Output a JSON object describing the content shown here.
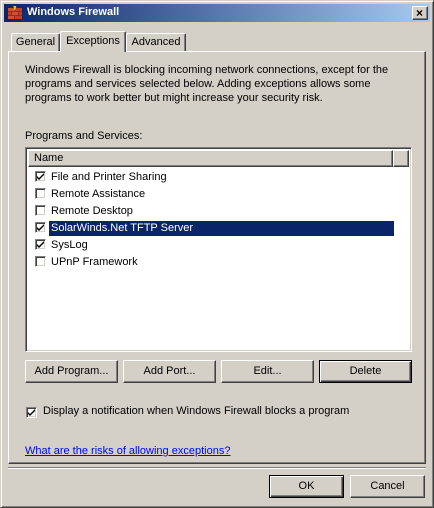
{
  "window": {
    "title": "Windows Firewall",
    "close_glyph": "×"
  },
  "tabs": [
    {
      "label": "General",
      "active": false
    },
    {
      "label": "Exceptions",
      "active": true
    },
    {
      "label": "Advanced",
      "active": false
    }
  ],
  "exceptions": {
    "description": "Windows Firewall is blocking incoming network connections, except for the programs and services selected below. Adding exceptions allows some programs to work better but might increase your security risk.",
    "section_label": "Programs and Services:",
    "column_header": "Name",
    "items": [
      {
        "label": "File and Printer Sharing",
        "checked": true,
        "selected": false
      },
      {
        "label": "Remote Assistance",
        "checked": false,
        "selected": false
      },
      {
        "label": "Remote Desktop",
        "checked": false,
        "selected": false
      },
      {
        "label": "SolarWinds.Net TFTP Server",
        "checked": true,
        "selected": true
      },
      {
        "label": "SysLog",
        "checked": true,
        "selected": false
      },
      {
        "label": "UPnP Framework",
        "checked": false,
        "selected": false
      }
    ],
    "buttons": {
      "add_program": "Add Program...",
      "add_port": "Add Port...",
      "edit": "Edit...",
      "delete": "Delete"
    },
    "notify_label": "Display a notification when Windows Firewall blocks a program",
    "notify_checked": true,
    "risk_link": "What are the risks of allowing exceptions?"
  },
  "footer": {
    "ok": "OK",
    "cancel": "Cancel"
  },
  "colors": {
    "titlebar_start": "#0a246a",
    "titlebar_end": "#a6caf0",
    "selection": "#0a246a",
    "link": "#0000ff",
    "face": "#d4d0c8"
  },
  "icons": {
    "title": "firewall-brick-icon",
    "close": "close-icon",
    "checkbox": "checkmark-icon"
  }
}
